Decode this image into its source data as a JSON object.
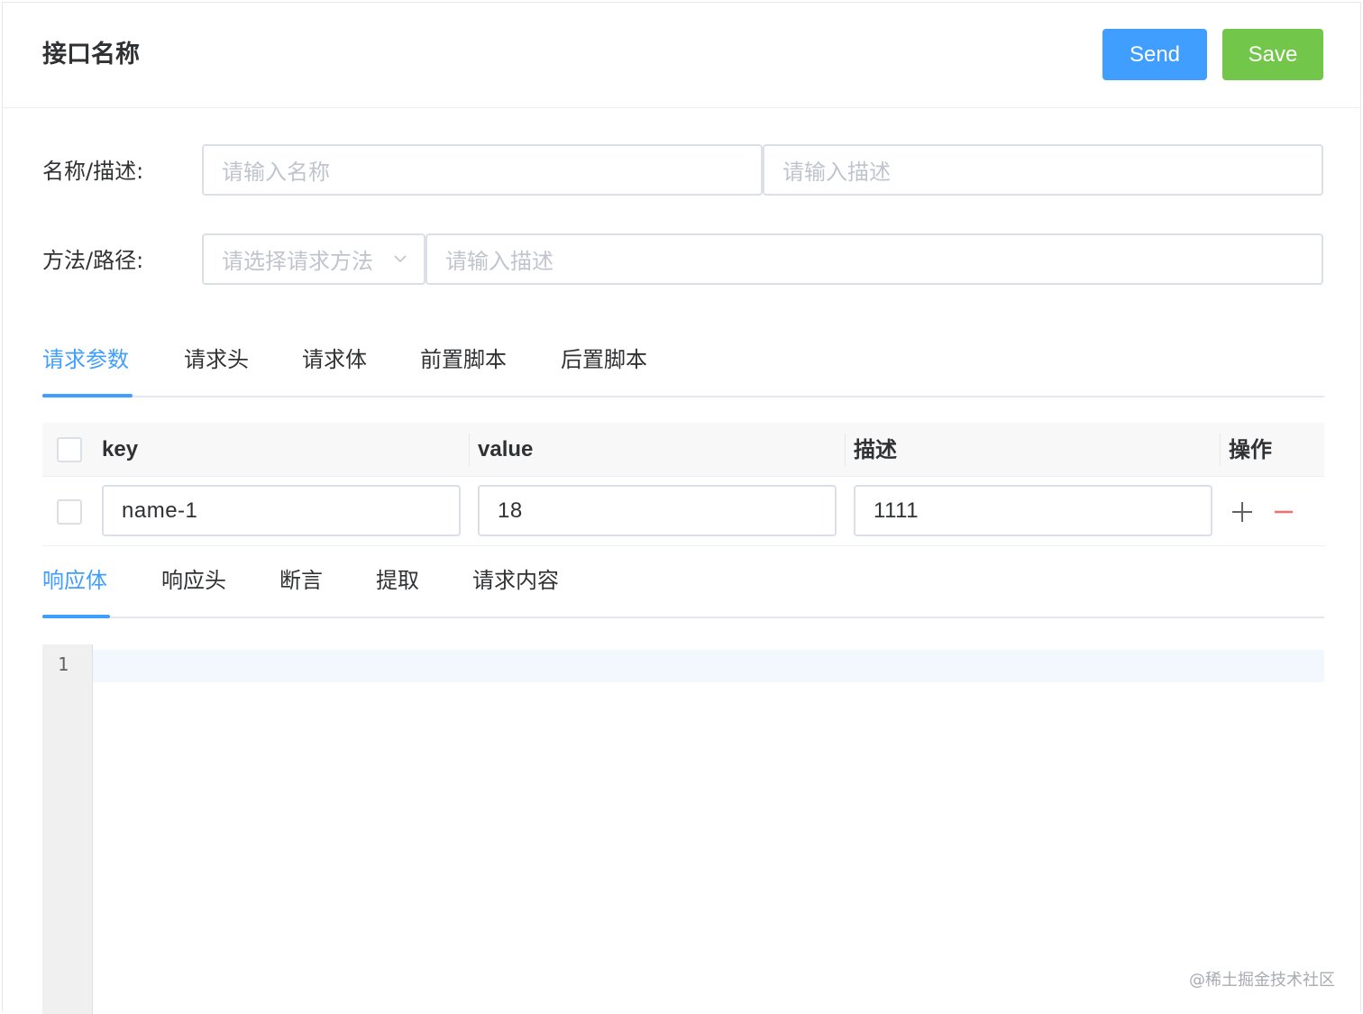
{
  "header": {
    "title": "接口名称",
    "send_label": "Send",
    "save_label": "Save"
  },
  "form": {
    "name_label": "名称/描述:",
    "name_placeholder": "请输入名称",
    "desc_placeholder": "请输入描述",
    "method_label": "方法/路径:",
    "method_placeholder": "请选择请求方法",
    "path_placeholder": "请输入描述"
  },
  "request_tabs": [
    {
      "label": "请求参数",
      "active": true
    },
    {
      "label": "请求头",
      "active": false
    },
    {
      "label": "请求体",
      "active": false
    },
    {
      "label": "前置脚本",
      "active": false
    },
    {
      "label": "后置脚本",
      "active": false
    }
  ],
  "params_table": {
    "columns": [
      "key",
      "value",
      "描述",
      "操作"
    ],
    "rows": [
      {
        "key": "name-1",
        "value": "18",
        "description": "1111"
      }
    ]
  },
  "response_tabs": [
    {
      "label": "响应体",
      "active": true
    },
    {
      "label": "响应头",
      "active": false
    },
    {
      "label": "断言",
      "active": false
    },
    {
      "label": "提取",
      "active": false
    },
    {
      "label": "请求内容",
      "active": false
    }
  ],
  "editor": {
    "line_numbers": [
      "1"
    ]
  },
  "watermark": "@稀土掘金技术社区",
  "colors": {
    "primary": "#409eff",
    "success": "#67c23a",
    "danger": "#f56c6c",
    "border": "#dcdfe6"
  },
  "icons": {
    "select_arrow": "chevron-down-icon",
    "add_row": "plus-icon",
    "remove_row": "minus-icon"
  }
}
